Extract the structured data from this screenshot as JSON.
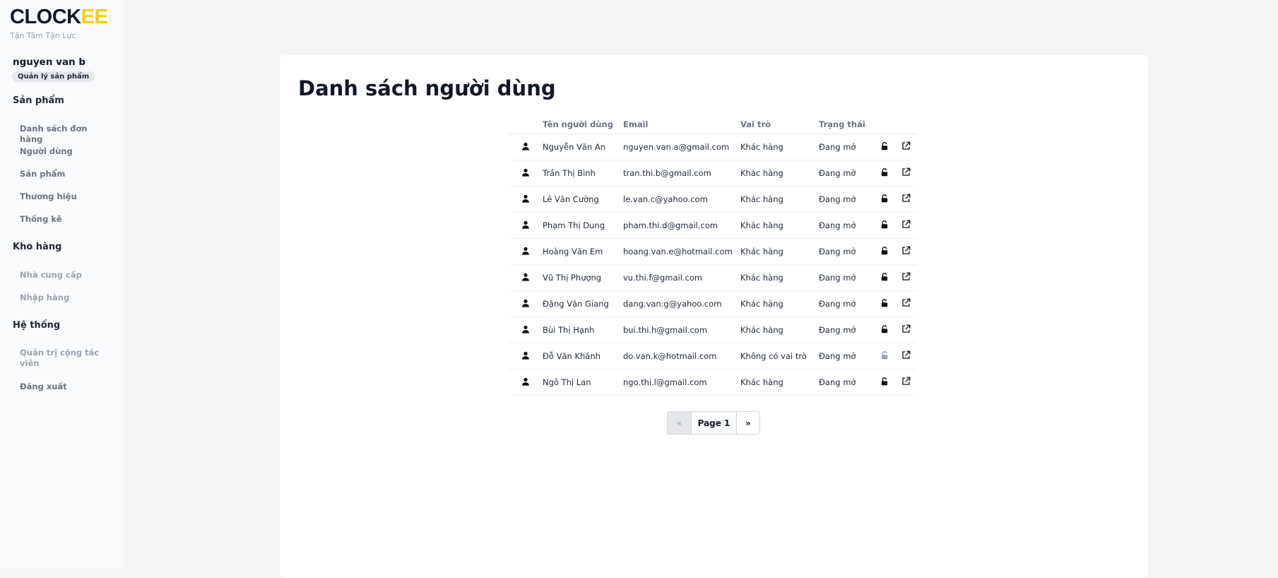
{
  "brand": {
    "part1": "CLOCK",
    "part2": "EE",
    "tagline": "Tận Tâm Tận Lực",
    "accent": "#facc15"
  },
  "user": {
    "name": "nguyen van b",
    "role": "Quản lý sản phẩm"
  },
  "sidebar": {
    "sections": [
      {
        "title": "Sản phẩm",
        "items": [
          "Danh sách đơn hàng",
          "Người dùng",
          "Sản phẩm",
          "Thương hiệu",
          "Thống kê"
        ]
      },
      {
        "title": "Kho hàng",
        "items": [
          "Nhà cung cấp",
          "Nhập hàng"
        ]
      },
      {
        "title": "Hệ thống",
        "items": [
          "Quản trị cộng tác viên",
          "Đăng xuất"
        ]
      }
    ]
  },
  "main": {
    "title": "Danh sách người dùng",
    "columns": [
      "Tên người dùng",
      "Email",
      "Vai trò",
      "Trạng thái"
    ],
    "rows": [
      {
        "name": "Nguyễn Văn An",
        "email": "nguyen.van.a@gmail.com",
        "role": "Khác hàng",
        "status": "Đang mở",
        "lock_icon": "unlock-icon"
      },
      {
        "name": "Trần Thị Bình",
        "email": "tran.thi.b@gmail.com",
        "role": "Khác hàng",
        "status": "Đang mở",
        "lock_icon": "unlock-icon"
      },
      {
        "name": "Lê Văn Cường",
        "email": "le.van.c@yahoo.com",
        "role": "Khác hàng",
        "status": "Đang mở",
        "lock_icon": "unlock-icon"
      },
      {
        "name": "Phạm Thị Dung",
        "email": "pham.thi.d@gmail.com",
        "role": "Khác hàng",
        "status": "Đang mở",
        "lock_icon": "unlock-icon"
      },
      {
        "name": "Hoàng Văn Em",
        "email": "hoang.van.e@hotmail.com",
        "role": "Khác hàng",
        "status": "Đang mở",
        "lock_icon": "unlock-icon"
      },
      {
        "name": "Vũ Thị Phượng",
        "email": "vu.thi.f@gmail.com",
        "role": "Khác hàng",
        "status": "Đang mở",
        "lock_icon": "unlock-icon"
      },
      {
        "name": "Đặng Văn Giang",
        "email": "dang.van.g@yahoo.com",
        "role": "Khác hàng",
        "status": "Đang mở",
        "lock_icon": "unlock-icon"
      },
      {
        "name": "Bùi Thị Hạnh",
        "email": "bui.thi.h@gmail.com",
        "role": "Khác hàng",
        "status": "Đang mở",
        "lock_icon": "unlock-icon"
      },
      {
        "name": "Đỗ Văn Khánh",
        "email": "do.van.k@hotmail.com",
        "role": "Không có vai trò",
        "status": "Đang mở",
        "lock_icon": "unlock-icon-disabled"
      },
      {
        "name": "Ngô Thị Lan",
        "email": "ngo.thi.l@gmail.com",
        "role": "Khác hàng",
        "status": "Đang mở",
        "lock_icon": "unlock-icon"
      }
    ]
  },
  "pagination": {
    "prev": "«",
    "current": "Page 1",
    "next": "»"
  }
}
